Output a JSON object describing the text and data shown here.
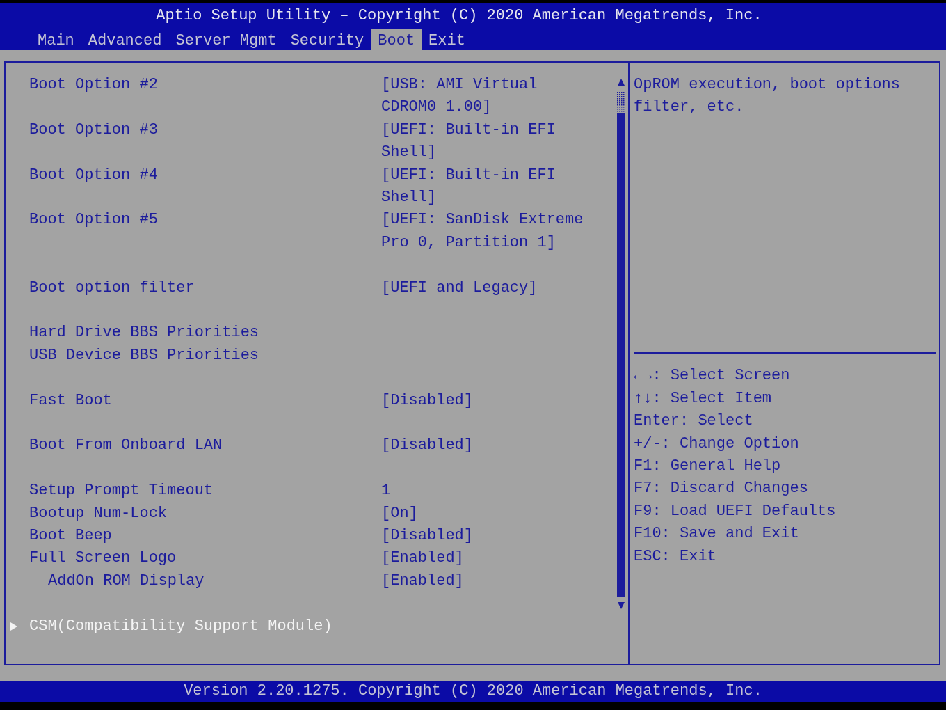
{
  "title": "Aptio Setup Utility – Copyright (C) 2020 American Megatrends, Inc.",
  "tabs": [
    {
      "label": "Main",
      "selected": false
    },
    {
      "label": "Advanced",
      "selected": false
    },
    {
      "label": "Server Mgmt",
      "selected": false
    },
    {
      "label": "Security",
      "selected": false
    },
    {
      "label": "Boot",
      "selected": true
    },
    {
      "label": "Exit",
      "selected": false
    }
  ],
  "items": [
    {
      "kind": "option",
      "label": "Boot Option #2",
      "value_lines": [
        "[USB: AMI Virtual",
        "CDROM0 1.00]"
      ],
      "selected": false
    },
    {
      "kind": "option",
      "label": "Boot Option #3",
      "value_lines": [
        "[UEFI: Built-in EFI",
        "Shell]"
      ],
      "selected": false
    },
    {
      "kind": "option",
      "label": "Boot Option #4",
      "value_lines": [
        "[UEFI: Built-in EFI",
        "Shell]"
      ],
      "selected": false
    },
    {
      "kind": "option",
      "label": "Boot Option #5",
      "value_lines": [
        "[UEFI: SanDisk Extreme",
        "Pro 0, Partition 1]"
      ],
      "selected": false
    },
    {
      "kind": "spacer"
    },
    {
      "kind": "option",
      "label": "Boot option filter",
      "value_lines": [
        "[UEFI and Legacy]"
      ],
      "selected": false
    },
    {
      "kind": "spacer"
    },
    {
      "kind": "option",
      "label": "Hard Drive BBS Priorities",
      "selected": false
    },
    {
      "kind": "option",
      "label": "USB Device BBS Priorities",
      "selected": false
    },
    {
      "kind": "spacer"
    },
    {
      "kind": "option",
      "label": "Fast Boot",
      "value_lines": [
        "[Disabled]"
      ],
      "selected": false
    },
    {
      "kind": "spacer"
    },
    {
      "kind": "option",
      "label": "Boot From Onboard LAN",
      "value_lines": [
        "[Disabled]"
      ],
      "selected": false
    },
    {
      "kind": "spacer"
    },
    {
      "kind": "option",
      "label": "Setup Prompt Timeout",
      "value_lines": [
        "1"
      ],
      "selected": false
    },
    {
      "kind": "option",
      "label": "Bootup Num-Lock",
      "value_lines": [
        "[On]"
      ],
      "selected": false
    },
    {
      "kind": "option",
      "label": "Boot Beep",
      "value_lines": [
        "[Disabled]"
      ],
      "selected": false
    },
    {
      "kind": "option",
      "label": "Full Screen Logo",
      "value_lines": [
        "[Enabled]"
      ],
      "selected": false,
      "children": [
        {
          "kind": "option",
          "label": "AddOn ROM Display",
          "value_lines": [
            "[Enabled]"
          ],
          "selected": false
        }
      ]
    },
    {
      "kind": "spacer"
    },
    {
      "kind": "submenu",
      "label": "CSM(Compatibility Support Module)",
      "selected": true
    }
  ],
  "help": {
    "description": [
      "OpROM execution, boot options",
      "filter, etc."
    ],
    "keys": [
      "←→: Select Screen",
      "↑↓: Select Item",
      "Enter: Select",
      "+/-: Change Option",
      "F1: General Help",
      "F7: Discard Changes",
      "F9: Load UEFI Defaults",
      "F10: Save and Exit",
      "ESC: Exit"
    ]
  },
  "footer": "Version 2.20.1275. Copyright (C) 2020 American Megatrends, Inc."
}
